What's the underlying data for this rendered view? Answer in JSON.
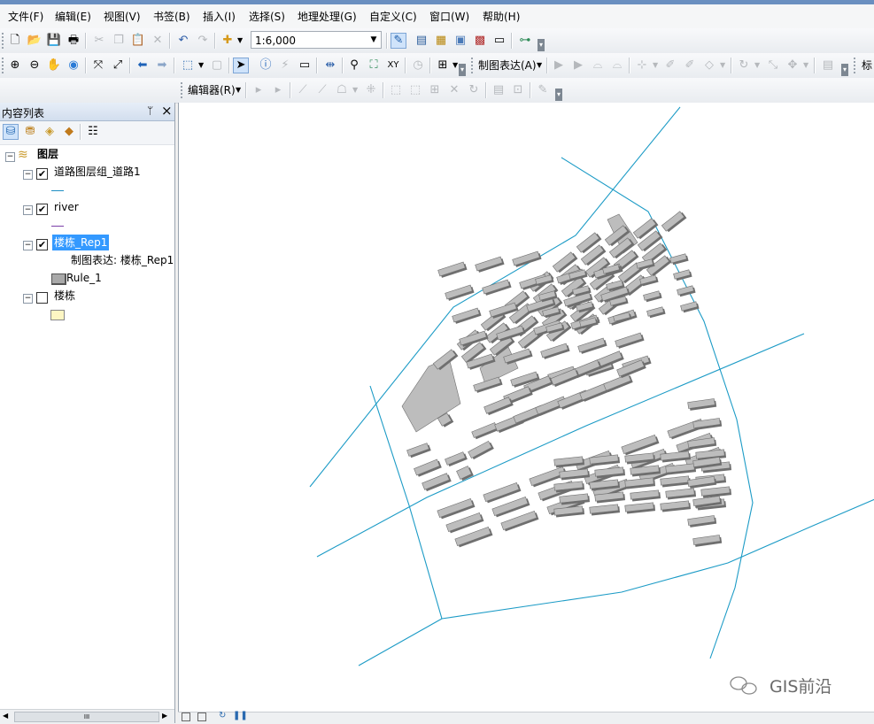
{
  "menu": [
    "文件(F)",
    "编辑(E)",
    "视图(V)",
    "书签(B)",
    "插入(I)",
    "选择(S)",
    "地理处理(G)",
    "自定义(C)",
    "窗口(W)",
    "帮助(H)"
  ],
  "toolbar": {
    "scale_value": "1:6,000",
    "representation_label": "制图表达(A)",
    "editor_label": "编辑器(R)",
    "overflow_label": "标"
  },
  "toc": {
    "title": "内容列表",
    "pin_glyph": "ᛘ",
    "close_glyph": "×",
    "layers_root": "图层",
    "layers": [
      {
        "name": "道路图层组_道路1",
        "checked": true,
        "symbol_color": "#1f8fc4"
      },
      {
        "name": "river",
        "checked": true,
        "symbol_color": "#7a3fa8"
      },
      {
        "name": "楼栋_Rep1",
        "checked": true,
        "sublabel": "制图表达: 楼栋_Rep1",
        "rule": "Rule_1"
      },
      {
        "name": "楼栋",
        "checked": false,
        "symbol_color": "#fdf6c3"
      }
    ],
    "scroll_thumb": "III"
  },
  "map": {
    "road_color": "#1c9bc6",
    "building_fill": "#bdbdbd",
    "watermark": "GIS前沿"
  },
  "icons": [
    "new-icon",
    "open-icon",
    "save-icon",
    "print-icon",
    "cut-icon",
    "copy-icon",
    "paste-icon",
    "delete-icon",
    "undo-icon",
    "redo-icon",
    "add-data-icon",
    "editor-toolbar-icon",
    "table-of-contents-icon",
    "catalog-icon",
    "search-window-icon",
    "arctoolbox-icon",
    "python-icon",
    "model-icon",
    "zoom-in-icon",
    "zoom-out-icon",
    "pan-icon",
    "full-extent-icon",
    "fixed-zoom-in-icon",
    "fixed-zoom-out-icon",
    "back-icon",
    "forward-icon",
    "select-features-icon",
    "clear-selection-icon",
    "select-elements-icon",
    "identify-icon",
    "hyperlink-icon",
    "html-popup-icon",
    "measure-icon",
    "find-icon",
    "find-route-icon",
    "goto-xy-icon",
    "time-slider-icon",
    "viewer-icon"
  ]
}
